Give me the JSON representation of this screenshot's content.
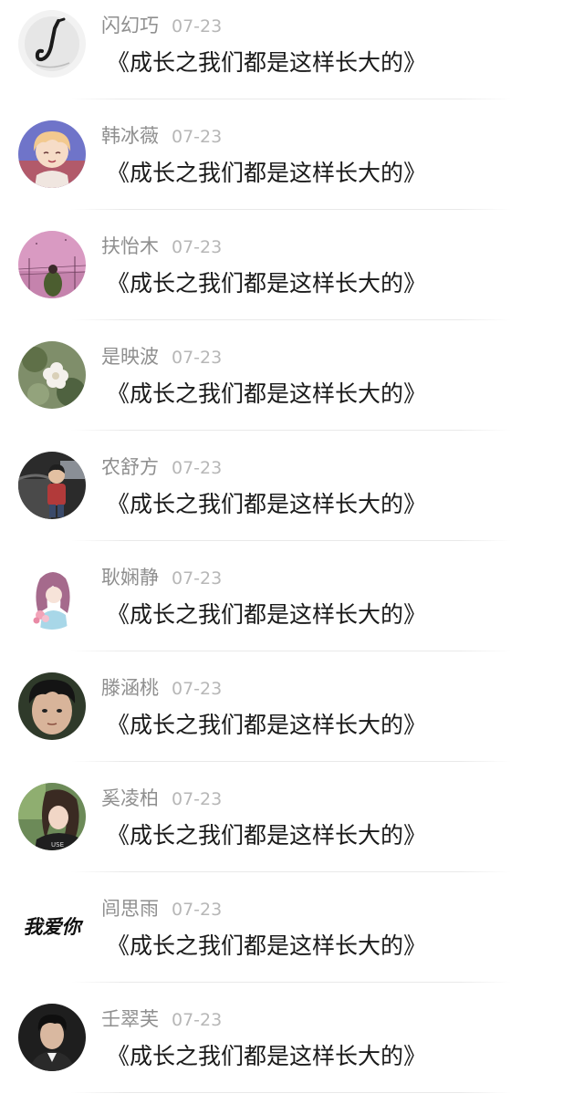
{
  "comments": [
    {
      "name": "闪幻巧",
      "date": "07-23",
      "text": "《成长之我们都是这样长大的》",
      "avatar_icon": "saxophone-avatar-icon"
    },
    {
      "name": "韩冰薇",
      "date": "07-23",
      "text": "《成长之我们都是这样长大的》",
      "avatar_icon": "anime-boy-avatar-icon"
    },
    {
      "name": "扶怡木",
      "date": "07-23",
      "text": "《成长之我们都是这样长大的》",
      "avatar_icon": "pink-sky-avatar-icon"
    },
    {
      "name": "是映波",
      "date": "07-23",
      "text": "《成长之我们都是这样长大的》",
      "avatar_icon": "flower-avatar-icon"
    },
    {
      "name": "农舒方",
      "date": "07-23",
      "text": "《成长之我们都是这样长大的》",
      "avatar_icon": "child-car-avatar-icon"
    },
    {
      "name": "耿娴静",
      "date": "07-23",
      "text": "《成长之我们都是这样长大的》",
      "avatar_icon": "illustrated-girl-avatar-icon"
    },
    {
      "name": "滕涵桃",
      "date": "07-23",
      "text": "《成长之我们都是这样长大的》",
      "avatar_icon": "boy-face-avatar-icon"
    },
    {
      "name": "奚凌柏",
      "date": "07-23",
      "text": "《成长之我们都是这样长大的》",
      "avatar_icon": "girl-selfie-avatar-icon"
    },
    {
      "name": "闾思雨",
      "date": "07-23",
      "text": "《成长之我们都是这样长大的》",
      "avatar_icon": "handwriting-avatar-icon",
      "avatar_text": "我爱你"
    },
    {
      "name": "壬翠芙",
      "date": "07-23",
      "text": "《成长之我们都是这样长大的》",
      "avatar_icon": "man-portrait-avatar-icon"
    }
  ]
}
